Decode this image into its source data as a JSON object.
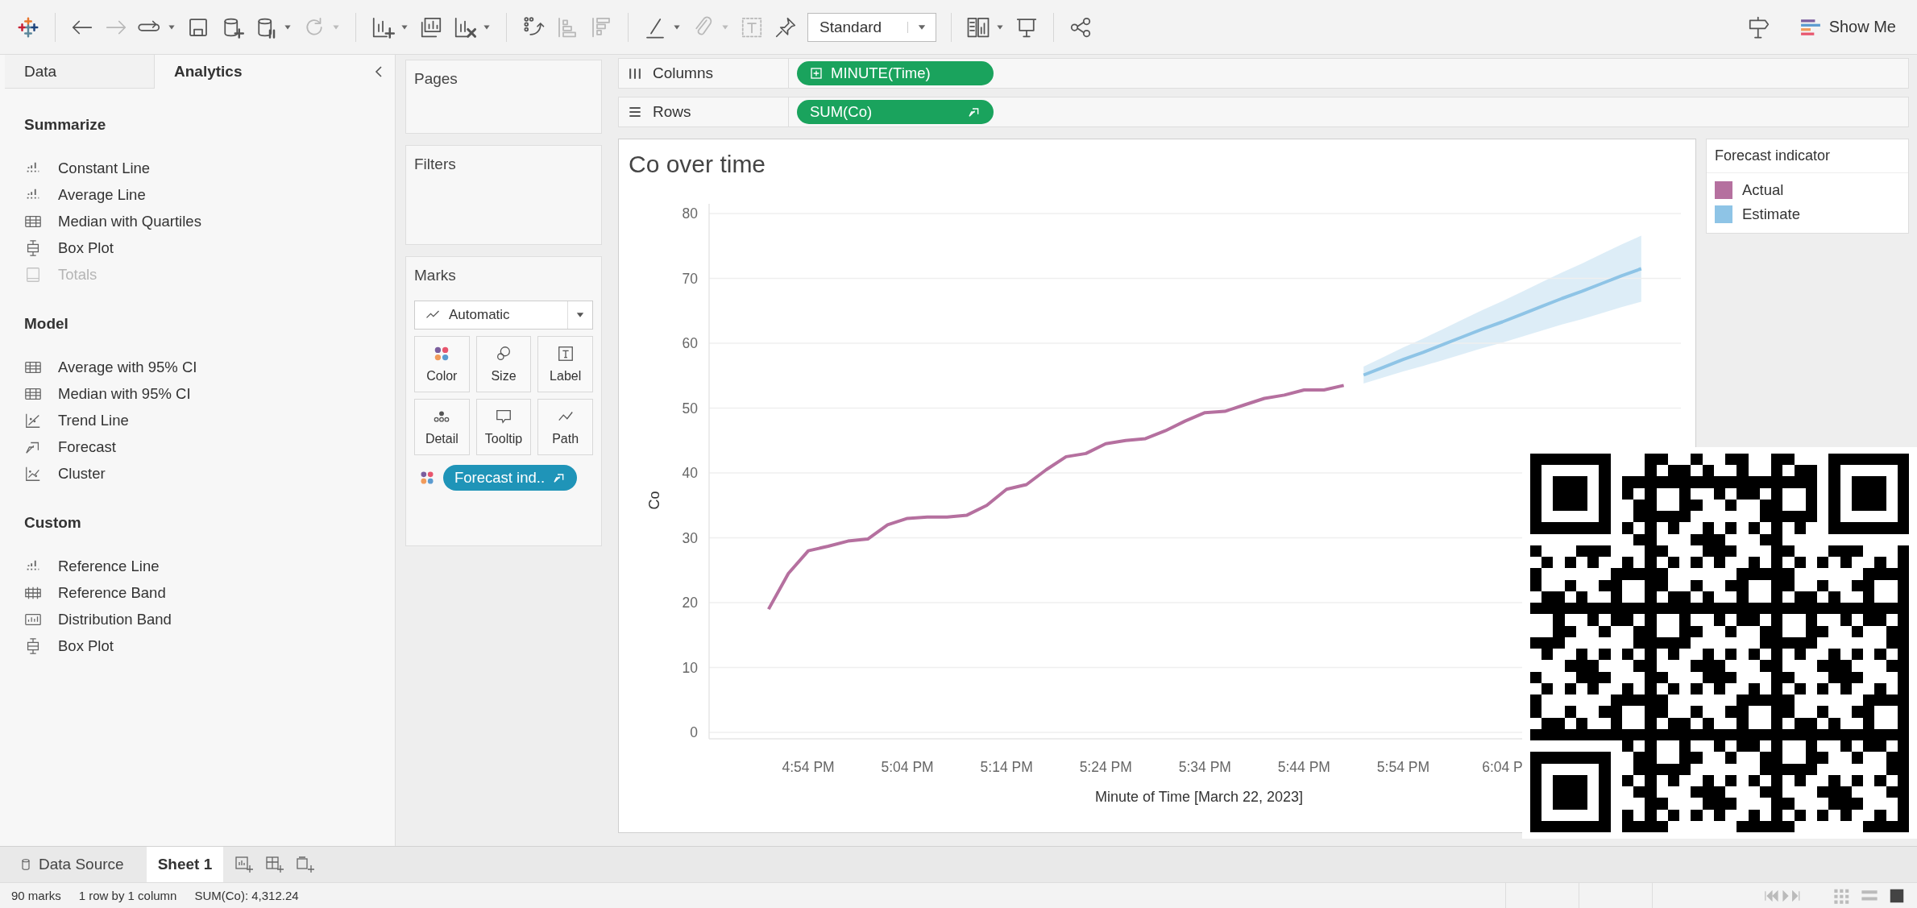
{
  "toolbar": {
    "items": [
      {
        "kind": "back",
        "disabled": false,
        "dropdown": false
      },
      {
        "kind": "forward",
        "disabled": true,
        "dropdown": false
      },
      {
        "kind": "replay",
        "disabled": false,
        "dropdown": true
      },
      {
        "kind": "save",
        "disabled": false,
        "dropdown": false
      },
      {
        "kind": "db-plus",
        "disabled": false,
        "dropdown": false
      },
      {
        "kind": "db-pause",
        "disabled": false,
        "dropdown": true
      },
      {
        "kind": "refresh",
        "disabled": true,
        "dropdown": true
      },
      {
        "kind": "sheet-plus",
        "disabled": false,
        "dropdown": true
      },
      {
        "kind": "duplicate",
        "disabled": false,
        "dropdown": false
      },
      {
        "kind": "clear",
        "disabled": false,
        "dropdown": true
      },
      {
        "kind": "swap",
        "disabled": false,
        "dropdown": false
      },
      {
        "kind": "sort-asc",
        "disabled": true,
        "dropdown": false
      },
      {
        "kind": "sort-desc",
        "disabled": true,
        "dropdown": false
      },
      {
        "kind": "pen",
        "disabled": false,
        "dropdown": true
      },
      {
        "kind": "clip",
        "disabled": true,
        "dropdown": true
      },
      {
        "kind": "text",
        "disabled": true,
        "dropdown": false
      },
      {
        "kind": "pin",
        "disabled": false,
        "dropdown": false
      }
    ],
    "fit": {
      "value": "Standard"
    },
    "items_after": [
      {
        "kind": "cards",
        "disabled": false,
        "dropdown": true
      },
      {
        "kind": "present",
        "disabled": false,
        "dropdown": false
      },
      {
        "kind": "share",
        "disabled": false,
        "dropdown": false
      }
    ],
    "show_me": "Show Me"
  },
  "left_panel": {
    "tabs": [
      {
        "label": "Data",
        "selected": false
      },
      {
        "label": "Analytics",
        "selected": true
      }
    ],
    "sections": [
      {
        "title": "Summarize",
        "items": [
          {
            "label": "Constant Line",
            "kind": "bars",
            "disabled": false
          },
          {
            "label": "Average Line",
            "kind": "bars",
            "disabled": false
          },
          {
            "label": "Median with Quartiles",
            "kind": "table",
            "disabled": false
          },
          {
            "label": "Box Plot",
            "kind": "box",
            "disabled": false
          },
          {
            "label": "Totals",
            "kind": "totals",
            "disabled": true
          }
        ]
      },
      {
        "title": "Model",
        "items": [
          {
            "label": "Average with 95% CI",
            "kind": "table",
            "disabled": false
          },
          {
            "label": "Median with 95% CI",
            "kind": "table",
            "disabled": false
          },
          {
            "label": "Trend Line",
            "kind": "trend",
            "disabled": false
          },
          {
            "label": "Forecast",
            "kind": "forecast",
            "disabled": false
          },
          {
            "label": "Cluster",
            "kind": "cluster",
            "disabled": false
          }
        ]
      },
      {
        "title": "Custom",
        "items": [
          {
            "label": "Reference Line",
            "kind": "bars",
            "disabled": false
          },
          {
            "label": "Reference Band",
            "kind": "band",
            "disabled": false
          },
          {
            "label": "Distribution Band",
            "kind": "distribution",
            "disabled": false
          },
          {
            "label": "Box Plot",
            "kind": "box",
            "disabled": false
          }
        ]
      }
    ]
  },
  "cards": {
    "pages": "Pages",
    "filters": "Filters",
    "marks": {
      "title": "Marks",
      "type": "Automatic",
      "buttons": [
        {
          "label": "Color",
          "kind": "color"
        },
        {
          "label": "Size",
          "kind": "size"
        },
        {
          "label": "Label",
          "kind": "label"
        },
        {
          "label": "Detail",
          "kind": "detail"
        },
        {
          "label": "Tooltip",
          "kind": "tooltip"
        },
        {
          "label": "Path",
          "kind": "path"
        }
      ],
      "pills": [
        {
          "label": "Forecast ind..",
          "kind": "color"
        }
      ]
    }
  },
  "shelves": [
    {
      "label": "Columns",
      "kind": "columns",
      "pill": "MINUTE(Time)"
    },
    {
      "label": "Rows",
      "kind": "rows",
      "pill": "SUM(Co)"
    }
  ],
  "chart": {
    "title": "Co over time",
    "chart_data": {
      "type": "line",
      "xlabel": "Minute of Time [March 22, 2023]",
      "ylabel": "Co",
      "categories": [
        null,
        null,
        "4:54 PM",
        null,
        null,
        null,
        null,
        "5:04 PM",
        null,
        null,
        null,
        null,
        "5:14 PM",
        null,
        null,
        null,
        null,
        "5:24 PM",
        null,
        null,
        null,
        null,
        "5:34 PM",
        null,
        null,
        null,
        null,
        "5:44 PM",
        null,
        null,
        null,
        null,
        "5:54 PM",
        null,
        null,
        null,
        null,
        "6:04 P",
        null,
        null,
        null,
        null,
        null,
        null,
        null
      ],
      "series": [
        {
          "name": "Actual",
          "color": "#b5709f",
          "values": [
            19,
            24.5,
            28,
            28.7,
            29.5,
            29.8,
            32,
            33,
            33.2,
            33.2,
            33.5,
            35,
            37.5,
            38.2,
            40.5,
            42.5,
            43,
            44.5,
            45,
            45.3,
            46.5,
            48,
            49.3,
            49.5,
            50.5,
            51.5,
            52,
            52.8,
            52.8,
            53.5,
            null,
            null,
            null,
            null,
            null,
            null,
            null,
            null,
            null,
            null,
            null,
            null,
            null,
            null,
            null
          ]
        },
        {
          "name": "Estimate",
          "color": "#8ec4e6",
          "values": [
            null,
            null,
            null,
            null,
            null,
            null,
            null,
            null,
            null,
            null,
            null,
            null,
            null,
            null,
            null,
            null,
            null,
            null,
            null,
            null,
            null,
            null,
            null,
            null,
            null,
            null,
            null,
            null,
            null,
            null,
            55.1,
            56.3,
            57.5,
            58.6,
            59.8,
            61.0,
            62.2,
            63.3,
            64.5,
            65.7,
            66.9,
            68.0,
            69.2,
            70.4,
            71.5
          ]
        }
      ],
      "grid": true,
      "ylim": [
        0,
        81.5
      ],
      "yticks": [
        0,
        10,
        20,
        30,
        40,
        50,
        60,
        70,
        80
      ]
    }
  },
  "legend": {
    "title": "Forecast indicator"
  },
  "sheet_tabs": [
    {
      "label": "Data Source",
      "kind": "datasource",
      "selected": false
    },
    {
      "label": "Sheet 1",
      "kind": "sheet",
      "selected": true
    }
  ],
  "status_bar": [
    "90 marks",
    "1 row by 1 column",
    "SUM(Co): 4,312.24"
  ]
}
